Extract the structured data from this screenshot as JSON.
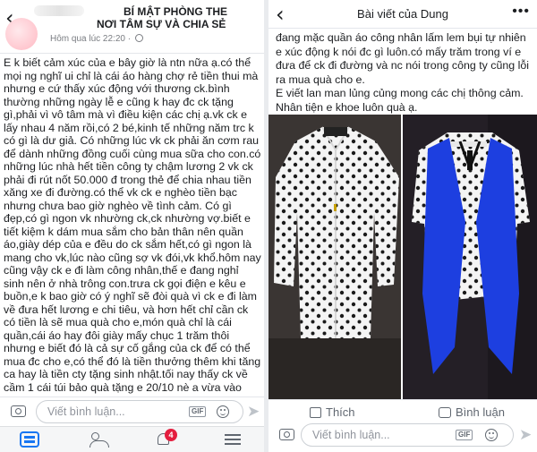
{
  "left": {
    "group_title": "BÍ MẬT PHÒNG THE",
    "group_subtitle": "NƠI TÂM SỰ VÀ CHIA SẺ",
    "time": "Hôm qua lúc 22:20 ·",
    "post_text": "E k biết cảm xúc của e bây giờ là ntn nữa ạ.có thể mọi ng nghĩ ui chỉ là cái áo hàng chợ rẻ tiền thui mà nhưng e cứ thấy xúc động với thương ck.bình thường những ngày lễ e cũng k hay đc ck tặng gì,phải vì vô tâm mà vì điều kiện các chị ạ.vk ck e lấy nhau 4 năm rồi,có 2 bé,kinh tế những năm trc k có gì là dư giả. Có những lúc vk ck phải ăn cơm rau để dành những đồng cuối cùng mua sữa cho con.có những lúc nhà hết tiền công ty chậm lương  2 vk ck phải đi rút nốt 50.000 đ trong thẻ để chia nhau tiền xăng xe đi đường.có thể vk ck e nghèo tiền bạc nhưng chưa bao giờ nghèo về tình cảm. Có gì đẹp,có gì ngon vk nhường ck,ck nhường vợ.biết e tiết kiệm k dám mua sắm cho bản thân nên quần áo,giày dép của e đều do ck sắm hết,có gì ngon là mang cho vk,lúc nào cũng sợ vk đói,vk khổ.hôm nay cũng vậy ck e đi làm công nhân,thế e  đang nghỉ sinh nên ở nhà trông con.trưa ck gọi điện e kêu e buồn,e k bao giờ có ý nghĩ sẽ đòi quà vì ck e đi làm về đưa hết lương e chi tiêu, và hơn hết chỉ cần ck có tiền là sẽ mua quà cho e,món quà chỉ là cái quần,cái áo hay đôi giày mấy chục 1 trăm thôi nhưng e biết đó là cả sự cố gắng của ck để có thể mua đc cho e,có thể đó là tiền thưởng thêm khi tăng ca hay là tiền cty tặng sinh nhật.tối nay thấy ck về cầm 1 cái túi bảo quà tặng e 20/10 nè a vừa vào chợ mua đấy.nhìn lại ck thì vẫn đang mặc quần áo công nhân lấm lem bụi tự nhiên e xúc động k nói đc gì luôn.có mấy trăm trong ví e đưa",
    "comment_placeholder": "Viết bình luận...",
    "gif_label": "GIF",
    "notification_count": "4",
    "icons": [
      "back-arrow-icon",
      "globe-icon",
      "camera-icon",
      "gif-icon",
      "emoji-icon",
      "send-icon",
      "home-icon",
      "friends-icon",
      "bell-icon",
      "menu-icon"
    ]
  },
  "right": {
    "title": "Bài viết của Dung",
    "more": "•••",
    "post_text": "đang mặc quần áo công nhân lấm lem bụi tự nhiên e xúc động k nói đc gì luôn.có mấy trăm trong ví e đưa để ck đi đường và nc nói trong công ty cũng lỗi ra mua quà cho e.\nE viết lan man lủng củng mong các chị thông cảm. Nhân tiện e khoe luôn quà ạ.",
    "like_label": "Thích",
    "comment_label": "Bình luận",
    "comment_placeholder": "Viết bình luận...",
    "gif_label": "GIF"
  },
  "colors": {
    "accent": "#1877f2",
    "badge": "#e41e3f",
    "vest": "#1d3fe0"
  }
}
